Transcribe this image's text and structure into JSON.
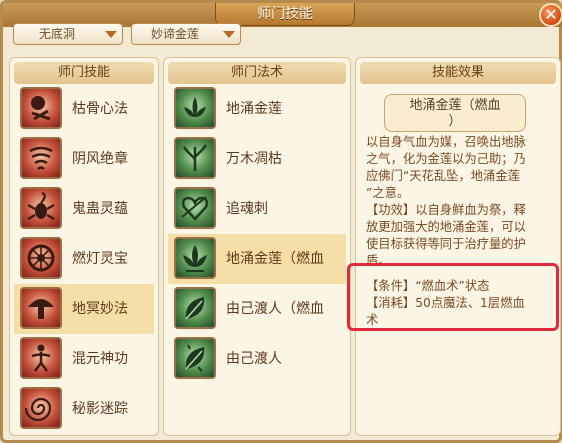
{
  "window": {
    "title": "师门技能"
  },
  "dropdowns": {
    "sect": {
      "value": "无底洞"
    },
    "skill": {
      "value": "妙谛金莲"
    }
  },
  "panels": {
    "sect_skills": {
      "header": "师门技能"
    },
    "sect_spells": {
      "header": "师门法术"
    },
    "effect": {
      "header": "技能效果"
    }
  },
  "sect_skills": [
    {
      "label": "枯骨心法",
      "icon": "bone-skull-icon"
    },
    {
      "label": "阴风绝章",
      "icon": "whirlwind-icon"
    },
    {
      "label": "鬼蛊灵蕴",
      "icon": "scorpion-icon"
    },
    {
      "label": "燃灯灵宝",
      "icon": "wheel-icon"
    },
    {
      "label": "地冥妙法",
      "icon": "mushroom-icon"
    },
    {
      "label": "混元神功",
      "icon": "dancer-icon"
    },
    {
      "label": "秘影迷踪",
      "icon": "swirl-icon"
    }
  ],
  "sect_spells": [
    {
      "label": "地涌金莲",
      "icon": "lotus-icon"
    },
    {
      "label": "万木凋枯",
      "icon": "withered-tree-icon"
    },
    {
      "label": "追魂刺",
      "icon": "heart-arrow-icon"
    },
    {
      "label": "地涌金莲（燃血",
      "icon": "lotus-flame-icon"
    },
    {
      "label": "由己渡人（燃血",
      "icon": "leaf-flame-icon"
    },
    {
      "label": "由己渡人",
      "icon": "leaf-icon"
    }
  ],
  "effect": {
    "title_line1": "地涌金莲（燃血",
    "title_line2": "）",
    "lines": [
      "以自身气血为媒，召唤出地脉",
      "之气，化为金莲以为己助；乃",
      "应佛门“天花乱坠，地涌金莲",
      "”之意。",
      "【功效】以自身鲜血为祭，释",
      "放更加强大的地涌金莲，可以",
      "使目标获得等同于治疗量的护",
      "盾。",
      "【条件】“燃血术”状态",
      "【消耗】50点魔法、1层燃血",
      "术"
    ]
  },
  "colors": {
    "highlight": "#e02a3c",
    "selected_row": "#f6dfa6"
  }
}
